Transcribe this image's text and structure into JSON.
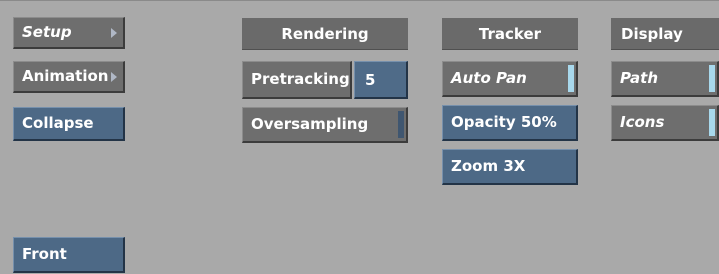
{
  "left_column": {
    "setup_label": "Setup",
    "animation_label": "Animation",
    "collapse_label": "Collapse",
    "front_label": "Front"
  },
  "rendering": {
    "header": "Rendering",
    "pretracking_label": "Pretracking",
    "pretracking_value": "5",
    "oversampling_label": "Oversampling"
  },
  "tracker": {
    "header": "Tracker",
    "auto_pan_label": "Auto Pan",
    "opacity_label": "Opacity 50%",
    "zoom_label": "Zoom 3X"
  },
  "display": {
    "header": "Display",
    "path_label": "Path",
    "icons_label": "Icons"
  },
  "colors": {
    "background": "#a9a9a9",
    "gray_button": "#6e6e6e",
    "blue_button": "#4d6986",
    "toggle_on": "#a8d8ec"
  }
}
